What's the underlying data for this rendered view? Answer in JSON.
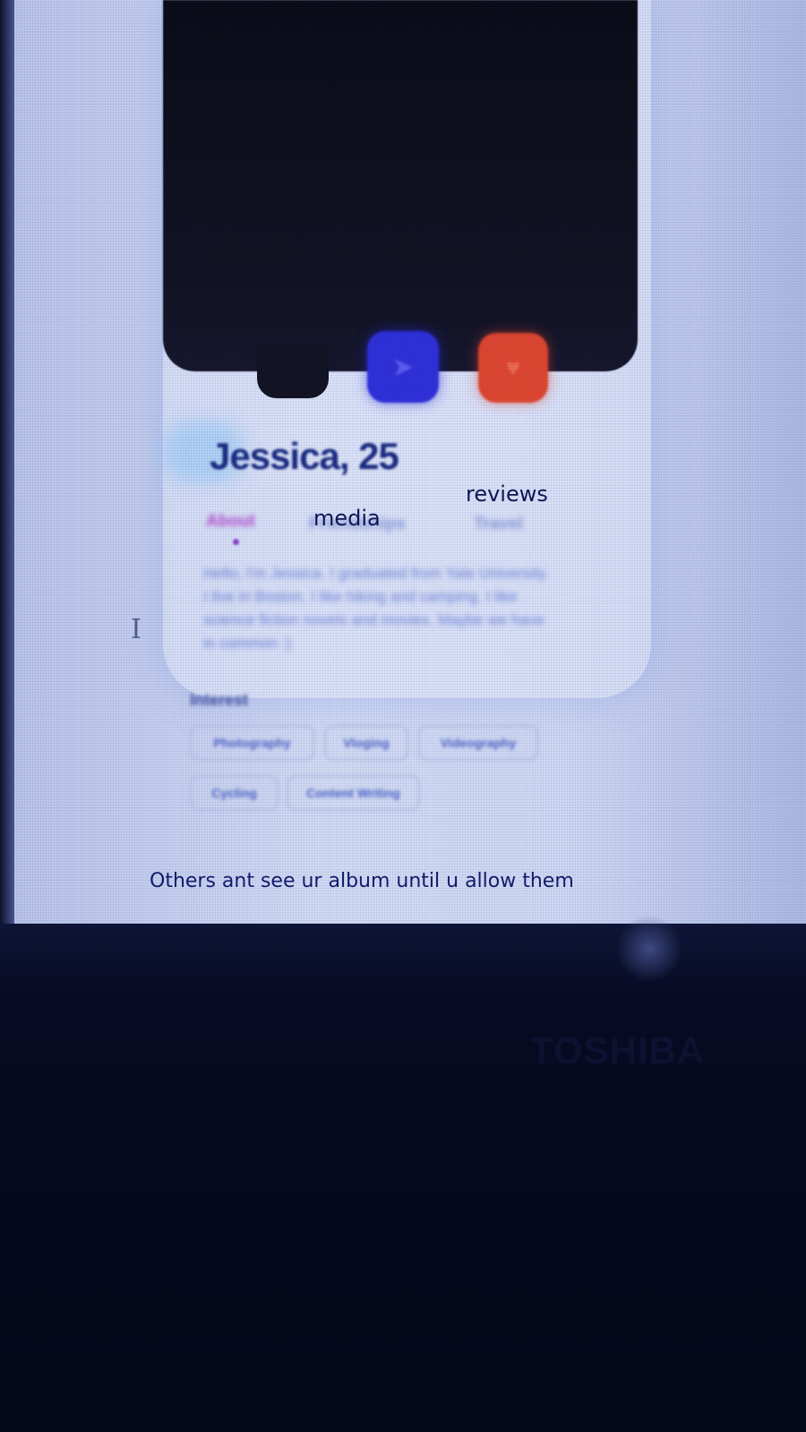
{
  "profile": {
    "name": "Jessica, 25",
    "tabs": {
      "about": "About",
      "friendships": "Friendships",
      "travel": "Travel"
    },
    "bio": "Hello, I'm Jessica. I graduated from Yale University. I live in Boston. I like hiking and camping. I like science fiction novels and movies. Maybe we have in common :)"
  },
  "annotations": {
    "media": "media",
    "reviews": "reviews",
    "caption": "Others ant see ur album until u allow them"
  },
  "interests": {
    "heading": "Interest",
    "chips": [
      "Photography",
      "Vloging",
      "Videography",
      "Cycling",
      "Content Writing"
    ]
  },
  "device": {
    "brand": "TOSHIBA"
  },
  "icons": {
    "share": "share-icon",
    "like": "heart-icon",
    "cursor": "text-cursor-icon"
  },
  "colors": {
    "share_button": "#2e2fd8",
    "like_button": "#e0442c",
    "name": "#1a2a80",
    "active_tab": "#b34bd0"
  }
}
